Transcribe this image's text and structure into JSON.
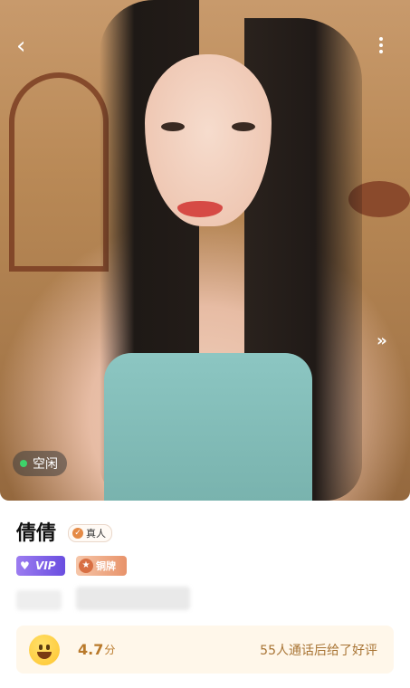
{
  "profile": {
    "name": "倩倩",
    "verified_label": "真人",
    "status": "空闲",
    "status_color": "#3ed36a"
  },
  "badges": {
    "vip_label": "VIP",
    "rank_label": "铜牌"
  },
  "rating": {
    "score": "4.7",
    "unit": "分",
    "review_text": "55人通话后给了好评"
  },
  "icons": {
    "back": "chevron-left-icon",
    "more": "more-vertical-icon",
    "next": "double-chevron-right-icon"
  }
}
